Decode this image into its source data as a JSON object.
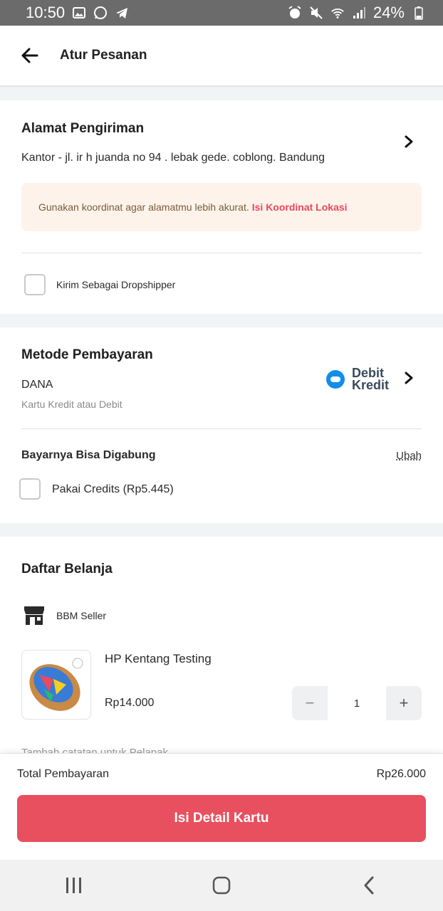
{
  "status_bar": {
    "time": "10:50",
    "battery": "24%"
  },
  "app_bar": {
    "title": "Atur Pesanan"
  },
  "address": {
    "title": "Alamat Pengiriman",
    "text": "Kantor - jl. ir h juanda no 94 . lebak gede. coblong. Bandung",
    "notice_text": "Gunakan koordinat agar alamatmu lebih akurat.",
    "notice_link": "Isi Koordinat Lokasi",
    "dropshipper_label": "Kirim Sebagai Dropshipper"
  },
  "payment": {
    "title": "Metode Pembayaran",
    "method": "DANA",
    "subtitle": "Kartu Kredit atau Debit",
    "logo_line1": "Debit",
    "logo_line2": "Kredit",
    "combined_title": "Bayarnya Bisa Digabung",
    "change_label": "Ubah",
    "credits_label": "Pakai Credits (Rp5.445)"
  },
  "cart": {
    "title": "Daftar Belanja",
    "seller": "BBM Seller",
    "product_name": "HP Kentang Testing",
    "price": "Rp14.000",
    "quantity": "1",
    "minus": "−",
    "plus": "+",
    "note_placeholder": "Tambah catatan untuk Pelapak"
  },
  "summary": {
    "total_label": "Total Pembayaran",
    "total_value": "Rp26.000",
    "button": "Isi Detail Kartu"
  },
  "colors": {
    "accent": "#e8505f",
    "link": "#e8475f",
    "notice_bg": "#fdf3ea",
    "dana_blue": "#118eea"
  }
}
